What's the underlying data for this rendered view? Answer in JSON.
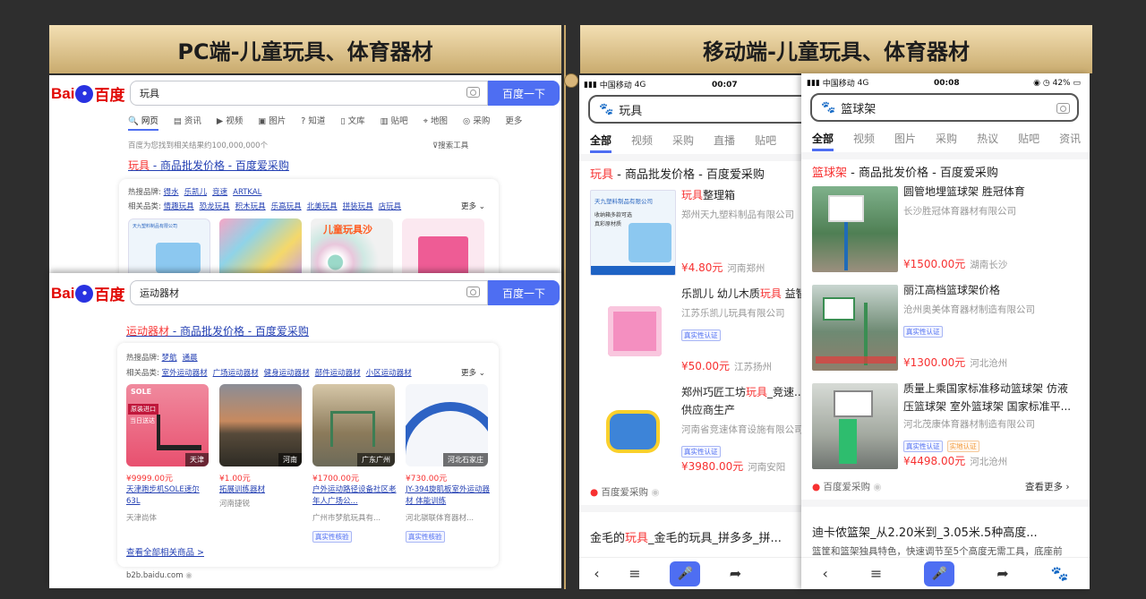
{
  "headers": {
    "pc": "PC端-儿童玩具、体育器材",
    "mobile": "移动端-儿童玩具、体育器材"
  },
  "logo": {
    "bai": "Bai",
    "paw": "du",
    "du": "百度"
  },
  "pc1": {
    "query": "玩具",
    "button": "百度一下",
    "tabs": [
      "网页",
      "资讯",
      "视频",
      "图片",
      "知道",
      "文库",
      "贴吧",
      "地图",
      "采购",
      "更多"
    ],
    "result_count": "百度为您找到相关结果约100,000,000个",
    "tools": "搜索工具",
    "title_kw": "玩具",
    "title_rest": " - 商品批发价格 - 百度爱采购",
    "hot_label": "热搜品牌:",
    "hot": [
      "得水",
      "乐凯儿",
      "竞速",
      "ARTKAL"
    ],
    "rel_label": "相关品类:",
    "rel": [
      "情趣玩具",
      "恐龙玩具",
      "积木玩具",
      "乐高玩具",
      "北美玩具",
      "拼装玩具",
      "店玩具"
    ],
    "more": "更多",
    "thumb_text": [
      "天九塑料制品有限公司",
      "儿童玩具沙"
    ]
  },
  "pc2": {
    "query": "运动器材",
    "button": "百度一下",
    "title_kw": "运动器材",
    "title_rest": " - 商品批发价格 - 百度爱采购",
    "hot_label": "热搜品牌:",
    "hot": [
      "梦航",
      "通晨"
    ],
    "rel_label": "相关品类:",
    "rel": [
      "室外运动器材",
      "广场运动器材",
      "健身运动器材",
      "部件运动器材",
      "小区运动器材"
    ],
    "more": "更多",
    "products": [
      {
        "loc": "天津",
        "price": "¥9999.00元",
        "name": "天津跑步机SOLE速尔63L",
        "seller": "天津尚体",
        "badge": "",
        "sole": "SOLE",
        "promo": "原装进口",
        "promo2": "当日送达"
      },
      {
        "loc": "河南",
        "price": "¥1.00元",
        "name": "拓展训练器材",
        "seller": "河南捷锐",
        "badge": ""
      },
      {
        "loc": "广东广州",
        "price": "¥1700.00元",
        "name": "户外运动路径设备社区老年人广场公...",
        "seller": "广州市梦航玩具有...",
        "badge": "真实性核验"
      },
      {
        "loc": "河北石家庄",
        "price": "¥730.00元",
        "name": "JY-394旋肌板室外运动器材 体能训练",
        "seller": "河北骐联体育器材...",
        "badge": "真实性核验"
      }
    ],
    "see_all": "查看全部相关商品 >",
    "footer": "b2b.baidu.com"
  },
  "m1": {
    "carrier": "中国移动",
    "net": "4G",
    "time": "00:07",
    "query": "玩具",
    "tabs": [
      "全部",
      "视频",
      "采购",
      "直播",
      "贴吧"
    ],
    "title_kw": "玩具",
    "title_rest": " - 商品批发价格 - 百度爱采购",
    "items": [
      {
        "name_kw": "玩具",
        "name_rest": "整理箱",
        "seller": "郑州天九塑料制品有限公司",
        "price": "¥4.80元",
        "loc": "河南郑州",
        "badge": ""
      },
      {
        "name_pre": "乐凯儿 幼儿木质",
        "name_kw": "玩具",
        "name_rest": " 益智",
        "seller": "江苏乐凯儿玩具有限公司",
        "price": "¥50.00元",
        "loc": "江苏扬州",
        "badge": "真实性认证"
      },
      {
        "name_pre": "郑州巧匠工坊",
        "name_kw": "玩具",
        "name_rest": "_竞速...",
        "name2": "供应商生产",
        "seller": "河南省竞速体育设施有限公司",
        "price": "¥3980.00元",
        "loc": "河南安阳",
        "badge": "真实性认证"
      }
    ],
    "thumb_text": [
      "天九塑料制品有限公司",
      "收纳箱多款可选",
      "真彩原材质"
    ],
    "source": "百度爱采购",
    "next_pre": "金毛的",
    "next_kw": "玩具",
    "next_rest": "_金毛的玩具_拼多多_拼..."
  },
  "m2": {
    "carrier": "中国移动",
    "net": "4G",
    "time": "00:08",
    "battery": "42%",
    "query": "篮球架",
    "tabs": [
      "全部",
      "视频",
      "图片",
      "采购",
      "热议",
      "贴吧",
      "资讯"
    ],
    "title_kw": "篮球架",
    "title_rest": " - 商品批发价格 - 百度爱采购",
    "items": [
      {
        "line1": "圆管地埋篮球架 胜冠体育",
        "seller": "长沙胜冠体育器材有限公司",
        "price": "¥1500.00元",
        "loc": "湖南长沙",
        "badges": []
      },
      {
        "line1": "丽江高档篮球架价格",
        "seller": "沧州奥美体育器材制造有限公司",
        "price": "¥1300.00元",
        "loc": "河北沧州",
        "badges": [
          "真实性认证"
        ]
      },
      {
        "line1": "质量上乘国家标准移动篮球架 仿液",
        "line2": "压篮球架 室外篮球架 国家标准平...",
        "seller": "河北茂康体育器材制造有限公司",
        "price": "¥4498.00元",
        "loc": "河北沧州",
        "badges": [
          "真实性认证",
          "实地认证"
        ]
      }
    ],
    "source": "百度爱采购",
    "see_more": "查看更多",
    "next_title": "迪卡侬篮架_从2.20米到_3.05米.5种高度...",
    "next_desc": "篮筐和篮架独具特色，快速调节至5个高度无需工具，底座前"
  }
}
